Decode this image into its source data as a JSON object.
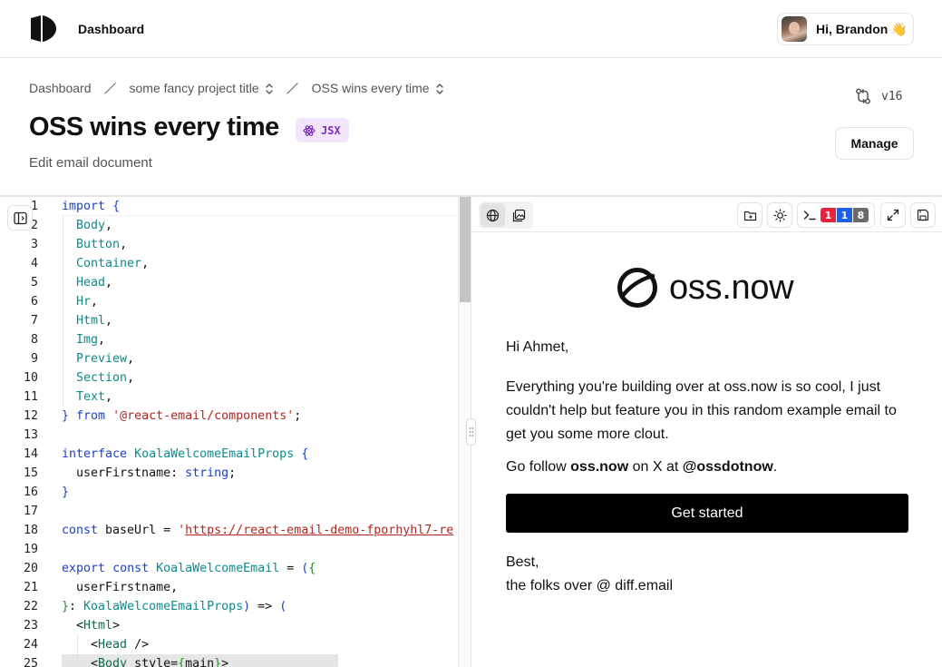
{
  "topbar": {
    "title": "Dashboard",
    "user_greeting": "Hi, Brandon 👋"
  },
  "breadcrumb": {
    "items": [
      "Dashboard",
      "some fancy project title",
      "OSS wins every time"
    ]
  },
  "version": "v16",
  "page": {
    "title": "OSS wins every time",
    "badge": "JSX",
    "subtitle": "Edit email document",
    "manage_label": "Manage"
  },
  "editor": {
    "lines": [
      {
        "n": "1",
        "parts": [
          [
            "kw",
            "import"
          ],
          [
            "p",
            " "
          ],
          [
            "brace",
            "{"
          ]
        ]
      },
      {
        "n": "2",
        "parts": [
          [
            "p",
            "  "
          ],
          [
            "comp",
            "Body"
          ],
          [
            "p",
            ","
          ]
        ]
      },
      {
        "n": "3",
        "parts": [
          [
            "p",
            "  "
          ],
          [
            "comp",
            "Button"
          ],
          [
            "p",
            ","
          ]
        ]
      },
      {
        "n": "4",
        "parts": [
          [
            "p",
            "  "
          ],
          [
            "comp",
            "Container"
          ],
          [
            "p",
            ","
          ]
        ]
      },
      {
        "n": "5",
        "parts": [
          [
            "p",
            "  "
          ],
          [
            "comp",
            "Head"
          ],
          [
            "p",
            ","
          ]
        ]
      },
      {
        "n": "6",
        "parts": [
          [
            "p",
            "  "
          ],
          [
            "comp",
            "Hr"
          ],
          [
            "p",
            ","
          ]
        ]
      },
      {
        "n": "7",
        "parts": [
          [
            "p",
            "  "
          ],
          [
            "comp",
            "Html"
          ],
          [
            "p",
            ","
          ]
        ]
      },
      {
        "n": "8",
        "parts": [
          [
            "p",
            "  "
          ],
          [
            "comp",
            "Img"
          ],
          [
            "p",
            ","
          ]
        ]
      },
      {
        "n": "9",
        "parts": [
          [
            "p",
            "  "
          ],
          [
            "comp",
            "Preview"
          ],
          [
            "p",
            ","
          ]
        ]
      },
      {
        "n": "10",
        "parts": [
          [
            "p",
            "  "
          ],
          [
            "comp",
            "Section"
          ],
          [
            "p",
            ","
          ]
        ]
      },
      {
        "n": "11",
        "parts": [
          [
            "p",
            "  "
          ],
          [
            "comp",
            "Text"
          ],
          [
            "p",
            ","
          ]
        ]
      },
      {
        "n": "12",
        "parts": [
          [
            "brace",
            "}"
          ],
          [
            "p",
            " "
          ],
          [
            "kw",
            "from"
          ],
          [
            "p",
            " "
          ],
          [
            "str",
            "'@react-email/components'"
          ],
          [
            "p",
            ";"
          ]
        ]
      },
      {
        "n": "13",
        "parts": []
      },
      {
        "n": "14",
        "parts": [
          [
            "kw",
            "interface"
          ],
          [
            "p",
            " "
          ],
          [
            "comp",
            "KoalaWelcomeEmailProps"
          ],
          [
            "p",
            " "
          ],
          [
            "brace",
            "{"
          ]
        ]
      },
      {
        "n": "15",
        "parts": [
          [
            "p",
            "  userFirstname: "
          ],
          [
            "typ",
            "string"
          ],
          [
            "p",
            ";"
          ]
        ]
      },
      {
        "n": "16",
        "parts": [
          [
            "brace",
            "}"
          ]
        ]
      },
      {
        "n": "17",
        "parts": []
      },
      {
        "n": "18",
        "parts": [
          [
            "kw",
            "const"
          ],
          [
            "p",
            " baseUrl = "
          ],
          [
            "str",
            "'"
          ],
          [
            "strlink",
            "https://react-email-demo-fporhyhl7-re"
          ]
        ]
      },
      {
        "n": "19",
        "parts": []
      },
      {
        "n": "20",
        "parts": [
          [
            "kw",
            "export"
          ],
          [
            "p",
            " "
          ],
          [
            "kw",
            "const"
          ],
          [
            "p",
            " "
          ],
          [
            "comp",
            "KoalaWelcomeEmail"
          ],
          [
            "p",
            " = "
          ],
          [
            "brace",
            "("
          ],
          [
            "brace-y",
            "{"
          ]
        ]
      },
      {
        "n": "21",
        "parts": [
          [
            "p",
            "  userFirstname,"
          ]
        ]
      },
      {
        "n": "22",
        "parts": [
          [
            "brace-y",
            "}"
          ],
          [
            "p",
            ": "
          ],
          [
            "comp",
            "KoalaWelcomeEmailProps"
          ],
          [
            "brace",
            ")"
          ],
          [
            "p",
            " => "
          ],
          [
            "brace",
            "("
          ]
        ]
      },
      {
        "n": "23",
        "parts": [
          [
            "p",
            "  <"
          ],
          [
            "tag",
            "Html"
          ],
          [
            "p",
            ">"
          ]
        ]
      },
      {
        "n": "24",
        "parts": [
          [
            "p",
            "    <"
          ],
          [
            "tag",
            "Head"
          ],
          [
            "p",
            " />"
          ]
        ]
      },
      {
        "n": "25",
        "parts": [
          [
            "p",
            "    <"
          ],
          [
            "tag",
            "Body"
          ],
          [
            "p",
            " style="
          ],
          [
            "brace-y",
            "{"
          ],
          [
            "p",
            "main"
          ],
          [
            "brace-y",
            "}"
          ],
          [
            "p",
            ">"
          ]
        ]
      }
    ]
  },
  "preview": {
    "error_count": "1",
    "info_count": "1",
    "other_count": "8",
    "email": {
      "brand": "oss.now",
      "greeting": "Hi Ahmet,",
      "paragraph": "Everything you're building over at oss.now is so cool, I just couldn't help but feature you in this random example email to get you some more clout.",
      "follow_prefix": "Go follow ",
      "follow_site": "oss.now",
      "follow_mid": " on X at ",
      "follow_handle": "@ossdotnow",
      "follow_suffix": ".",
      "cta": "Get started",
      "signoff_1": "Best,",
      "signoff_2": "the folks over @ diff.email"
    }
  },
  "colors": {
    "keyword": "#1a3ecf",
    "component": "#0d8a8a",
    "string": "#b3261e",
    "badge_bg": "#f1e6fb",
    "badge_fg": "#7b2fbe",
    "cta_bg": "#000000"
  },
  "icons": [
    "logo-icon",
    "chevron-updown-icon",
    "git-compare-icon",
    "react-atom-icon",
    "sidebar-toggle-icon",
    "globe-icon",
    "image-icon",
    "folder-icon",
    "sun-icon",
    "terminal-icon",
    "expand-icon",
    "save-icon",
    "grip-icon"
  ]
}
